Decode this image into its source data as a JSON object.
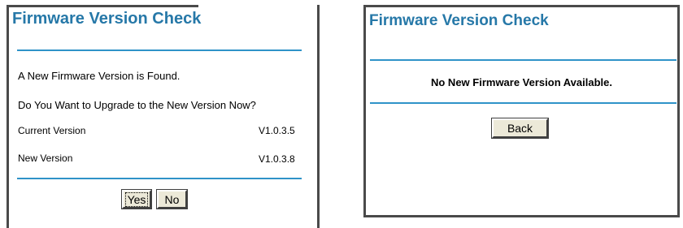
{
  "left_panel": {
    "title": "Firmware Version Check",
    "found_message": "A New Firmware Version is Found.",
    "upgrade_question": "Do You Want to Upgrade to the New Version Now?",
    "current_version_label": "Current Version",
    "current_version_value": "V1.0.3.5",
    "new_version_label": "New Version",
    "new_version_value": "V1.0.3.8",
    "yes_label": "Yes",
    "no_label": "No"
  },
  "right_panel": {
    "title": "Firmware Version Check",
    "message": "No New Firmware Version Available.",
    "back_label": "Back"
  },
  "colors": {
    "title": "#2678a8",
    "rule": "#2f93c8",
    "button_face": "#ece9d8"
  }
}
